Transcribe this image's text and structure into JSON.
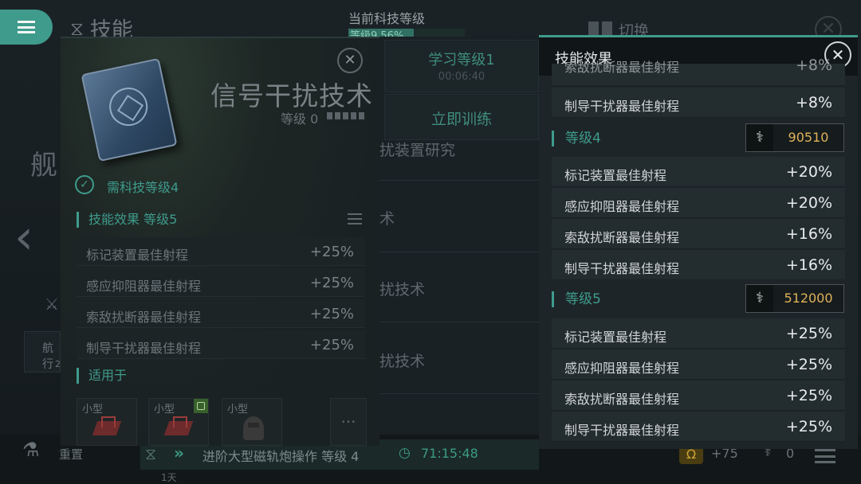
{
  "header": {
    "title": "技能",
    "tech_level_label": "当前科技等级",
    "tech_progress_text": "等级9  56%",
    "tech_progress": 0.56,
    "switch_label": "切换"
  },
  "middle": {
    "learn_label": "学习等级1",
    "learn_time": "00:06:40",
    "train_label": "立即训练",
    "items": [
      "扰装置研究",
      "术",
      "扰技术",
      "扰技术"
    ]
  },
  "left_strip": {
    "char": "舰",
    "box_label": "航行",
    "box_sub": "2"
  },
  "skill_panel": {
    "name": "信号干扰技术",
    "level": "等级 0",
    "requirement": "需科技等级4",
    "effects_title": "技能效果 等级5",
    "effects": [
      {
        "name": "标记装置最佳射程",
        "value": "+25%"
      },
      {
        "name": "感应抑阻器最佳射程",
        "value": "+25%"
      },
      {
        "name": "索敌扰断器最佳射程",
        "value": "+25%"
      },
      {
        "name": "制导干扰器最佳射程",
        "value": "+25%"
      }
    ],
    "applies_title": "适用于",
    "ships": [
      {
        "label": "小型"
      },
      {
        "label": "小型"
      },
      {
        "label": "小型"
      }
    ]
  },
  "popup": {
    "title": "技能效果",
    "top_rows": [
      {
        "name": "索敌扰断器最佳射程",
        "value": "+8%"
      },
      {
        "name": "制导干扰器最佳射程",
        "value": "+8%"
      }
    ],
    "levels": [
      {
        "label": "等级4",
        "cost": "90510",
        "rows": [
          {
            "name": "标记装置最佳射程",
            "value": "+20%"
          },
          {
            "name": "感应抑阻器最佳射程",
            "value": "+20%"
          },
          {
            "name": "索敌扰断器最佳射程",
            "value": "+16%"
          },
          {
            "name": "制导干扰器最佳射程",
            "value": "+16%"
          }
        ]
      },
      {
        "label": "等级5",
        "cost": "512000",
        "rows": [
          {
            "name": "标记装置最佳射程",
            "value": "+25%"
          },
          {
            "name": "感应抑阻器最佳射程",
            "value": "+25%"
          },
          {
            "name": "索敌扰断器最佳射程",
            "value": "+25%"
          },
          {
            "name": "制导干扰器最佳射程",
            "value": "+25%"
          }
        ]
      }
    ]
  },
  "bottom": {
    "reset_label": "重置",
    "queue_text": "进阶大型磁轨炮操作 等级 4",
    "queue_timer": "71:15:48",
    "queue_days": "1天",
    "plus_text": "+75",
    "item_count": "0"
  },
  "icons": {
    "menu": "hamburger-icon",
    "skill": "dna-icon",
    "close": "close-icon",
    "check": "check-icon",
    "cost": "syringe-icon",
    "clock": "clock-icon",
    "omega": "omega-icon"
  },
  "colors": {
    "accent": "#3f9b8c",
    "cost_value": "#e0b259"
  }
}
